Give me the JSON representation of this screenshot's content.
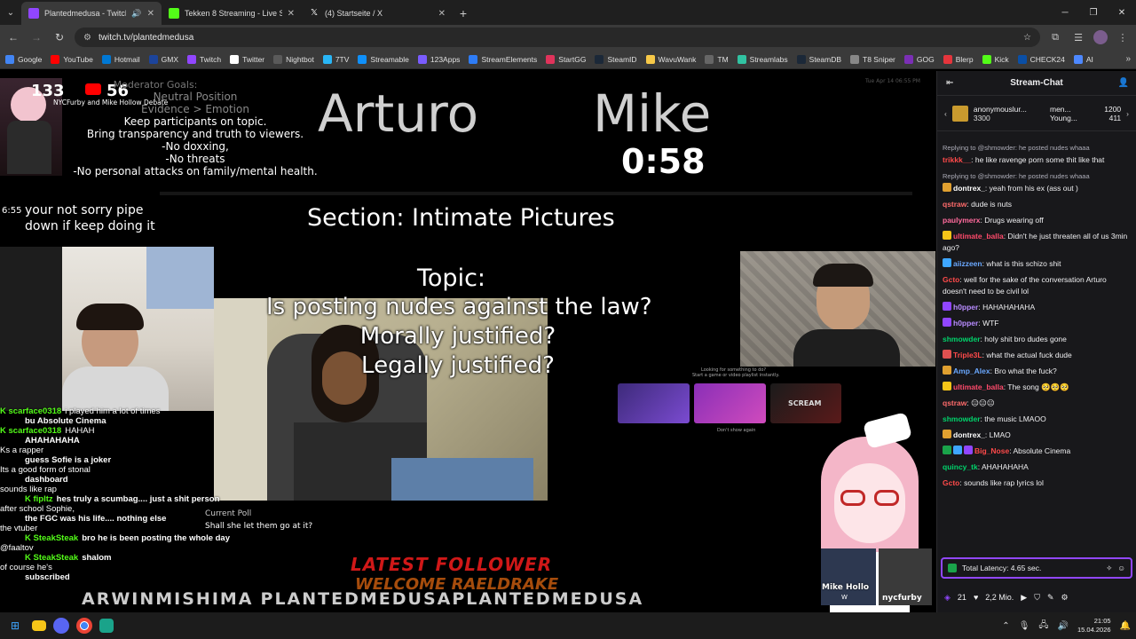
{
  "browser": {
    "tabs": [
      {
        "title": "Plantedmedusa - Twitch",
        "color": "#9146ff",
        "active": true,
        "audio": true
      },
      {
        "title": "Tekken 8 Streaming - Live Strea",
        "color": "#53fc18",
        "active": false,
        "audio": false
      },
      {
        "title": "(4) Startseite / X",
        "color": "#ffffff",
        "active": false,
        "audio": false
      }
    ],
    "new_tab": "+",
    "url": "twitch.tv/plantedmedusa",
    "bookmarks": [
      {
        "label": "Google",
        "color": "#4285f4"
      },
      {
        "label": "YouTube",
        "color": "#ff0000"
      },
      {
        "label": "Hotmail",
        "color": "#0078d4"
      },
      {
        "label": "GMX",
        "color": "#1c449b"
      },
      {
        "label": "Twitch",
        "color": "#9146ff"
      },
      {
        "label": "Twitter",
        "color": "#ffffff"
      },
      {
        "label": "Nightbot",
        "color": "#5a5a5a"
      },
      {
        "label": "7TV",
        "color": "#29b6f6"
      },
      {
        "label": "Streamable",
        "color": "#0f90fa"
      },
      {
        "label": "123Apps",
        "color": "#7a5cff"
      },
      {
        "label": "StreamElements",
        "color": "#2e7cf6"
      },
      {
        "label": "StartGG",
        "color": "#e0335b"
      },
      {
        "label": "SteamID",
        "color": "#1b2838"
      },
      {
        "label": "WavuWank",
        "color": "#f7c948"
      },
      {
        "label": "TM",
        "color": "#666666"
      },
      {
        "label": "Streamlabs",
        "color": "#31c3a2"
      },
      {
        "label": "SteamDB",
        "color": "#1b2838"
      },
      {
        "label": "T8 Sniper",
        "color": "#888888"
      },
      {
        "label": "GOG",
        "color": "#7b2fb5"
      },
      {
        "label": "Blerp",
        "color": "#e5353c"
      },
      {
        "label": "Kick",
        "color": "#53fc18"
      },
      {
        "label": "CHECK24",
        "color": "#0a4fa6"
      },
      {
        "label": "AI",
        "color": "#4d88ff"
      }
    ]
  },
  "stream": {
    "viewer_count_1": "133",
    "viewer_count_2": "56",
    "overlay_small": "NYCFurby and Mike Hollow Debate",
    "mod_goals_title": "Moderator Goals:",
    "mod_goals": [
      "Neutral Position",
      "Evidence > Emotion",
      "Keep participants on topic.",
      "Bring transparency and truth to viewers.",
      "-No doxxing,",
      "-No threats",
      "-No personal attacks on family/mental health."
    ],
    "name_left": "Arturo",
    "name_right": "Mike",
    "timer": "0:58",
    "datestamp": "Tue Apr 14 06:55 PM",
    "section": "Section:  Intimate Pictures",
    "topic_label": "Topic:",
    "topic_lines": [
      "Is posting nudes against the law?",
      "Morally justified?",
      "Legally justified?"
    ],
    "left_chat_time": "6:55",
    "left_chat_msg": "your not sorry pipe down if keep doing it",
    "current_poll_label": "Current Poll",
    "current_poll_question": "Shall she let them go at it?",
    "latest_follower": "LATEST FOLLOWER",
    "follower_name": "WELCOME RAELDRAKE",
    "socials": [
      "ARWINMISHIMA",
      "PLANTEDMEDUSA",
      "PLANTEDMEDUSA"
    ],
    "cam_labels": [
      "Mike Hollo",
      "nycfurby"
    ],
    "cam_sub": "W",
    "inner_ad_1": "Looking for something to do?",
    "inner_ad_2": "Start a game or video playlist instantly.",
    "inner_tile_label": "SCREAM",
    "inner_dont_show": "Don't show again",
    "overlay_chat": [
      {
        "user": "scarface0318",
        "text": "i played him a lot of times"
      },
      {
        "user": "",
        "text": "bu Absolute Cinema"
      },
      {
        "user": "scarface0318",
        "text": "HAHAH"
      },
      {
        "user": "",
        "text": "AHAHAHAHA"
      },
      {
        "user": "",
        "text": "Ks a rapper"
      },
      {
        "user": "",
        "text": "guess Sofie is a joker"
      },
      {
        "user": "",
        "text": "Its a good form of stonal"
      },
      {
        "user": "",
        "text": "dashboard"
      },
      {
        "user": "",
        "text": "sounds like rap"
      },
      {
        "user": "fipltz",
        "text": "hes truly a scumbag.... just a shit person"
      },
      {
        "user": "",
        "text": "after school Sophie,"
      },
      {
        "user": "",
        "text": "the FGC was his life.... nothing else"
      },
      {
        "user": "",
        "text": "the vtuber"
      },
      {
        "user": "SteakSteak",
        "text": "bro he is been posting the whole day"
      },
      {
        "user": "",
        "text": "@faaltov"
      },
      {
        "user": "SteakSteak",
        "text": "shalom"
      },
      {
        "user": "",
        "text": "of course he's"
      },
      {
        "user": "",
        "text": "subscribed"
      }
    ]
  },
  "chat": {
    "title": "Stream-Chat",
    "pinned": [
      {
        "name": "anonymouslur...",
        "amount": "3300"
      },
      {
        "name": "men...",
        "amount": "1200"
      },
      {
        "name": "Young...",
        "amount": "411"
      }
    ],
    "messages": [
      {
        "reply": "Replying to @shmowder: he posted nudes whaaa",
        "user": "trikkk__",
        "color": "#ff4a4a",
        "text": "he like ravenge porn some thit like that",
        "badges": []
      },
      {
        "reply": "Replying to @shmowder: he posted nudes whaaa",
        "user": "dontrex_",
        "color": "#ffffff",
        "text": "yeah from his ex (ass out )",
        "badges": [
          "#e0a030"
        ]
      },
      {
        "reply": "",
        "user": "qstraw",
        "color": "#ff6b6b",
        "text": "dude is nuts",
        "badges": []
      },
      {
        "reply": "",
        "user": "paulymerx",
        "color": "#ff6b9d",
        "text": "Drugs wearing off",
        "badges": []
      },
      {
        "reply": "",
        "user": "ultimate_balla",
        "color": "#ff4a6b",
        "text": "Didn't he just threaten all of us 3min ago?",
        "badges": [
          "#f5c518"
        ]
      },
      {
        "reply": "",
        "user": "aiizzeen",
        "color": "#6aa8ff",
        "text": "what is this schizo shit",
        "badges": [
          "#3ea6ff"
        ]
      },
      {
        "reply": "",
        "user": "Gcto",
        "color": "#ff4a4a",
        "text": "well for the sake of the conversation Arturo doesn't need to be civil lol",
        "badges": []
      },
      {
        "reply": "",
        "user": "h0pper",
        "color": "#b88cff",
        "text": "HAHAHAHAHA",
        "badges": [
          "#9146ff"
        ]
      },
      {
        "reply": "",
        "user": "h0pper",
        "color": "#b88cff",
        "text": "WTF",
        "badges": [
          "#9146ff"
        ]
      },
      {
        "reply": "",
        "user": "shmowder",
        "color": "#00d36b",
        "text": "holy shit bro dudes gone",
        "badges": []
      },
      {
        "reply": "",
        "user": "Triple3L",
        "color": "#ff4a4a",
        "text": "what the actual fuck dude",
        "badges": [
          "#e05050"
        ]
      },
      {
        "reply": "",
        "user": "Amp_Alex",
        "color": "#6aa8ff",
        "text": "Bro what the fuck?",
        "badges": [
          "#e0a030"
        ]
      },
      {
        "reply": "",
        "user": "ultimate_balla",
        "color": "#ff4a6b",
        "text": "The song 🥺🥺🥺",
        "badges": [
          "#f5c518"
        ]
      },
      {
        "reply": "",
        "user": "qstraw",
        "color": "#ff6b6b",
        "text": "😐😐😐",
        "badges": []
      },
      {
        "reply": "",
        "user": "shmowder",
        "color": "#00d36b",
        "text": "the music LMAOO",
        "badges": []
      },
      {
        "reply": "",
        "user": "dontrex_",
        "color": "#ffffff",
        "text": "LMAO",
        "badges": [
          "#e0a030"
        ]
      },
      {
        "reply": "",
        "user": "Big_Nose",
        "color": "#ff4a4a",
        "text": "Absolute Cinema",
        "badges": [
          "#1aa34a",
          "#3ea6ff",
          "#9146ff"
        ]
      },
      {
        "reply": "",
        "user": "quincy_tk",
        "color": "#00d36b",
        "text": "AHAHAHAHA",
        "badges": []
      },
      {
        "reply": "",
        "user": "Gcto",
        "color": "#ff4a4a",
        "text": "sounds like rap lyrics lol",
        "badges": []
      }
    ],
    "latency": "Total Latency: 4.65 sec.",
    "viewers": "21",
    "followers": "2,2 Mio."
  },
  "taskbar": {
    "time": "21:05",
    "date": "15.04.2026"
  }
}
